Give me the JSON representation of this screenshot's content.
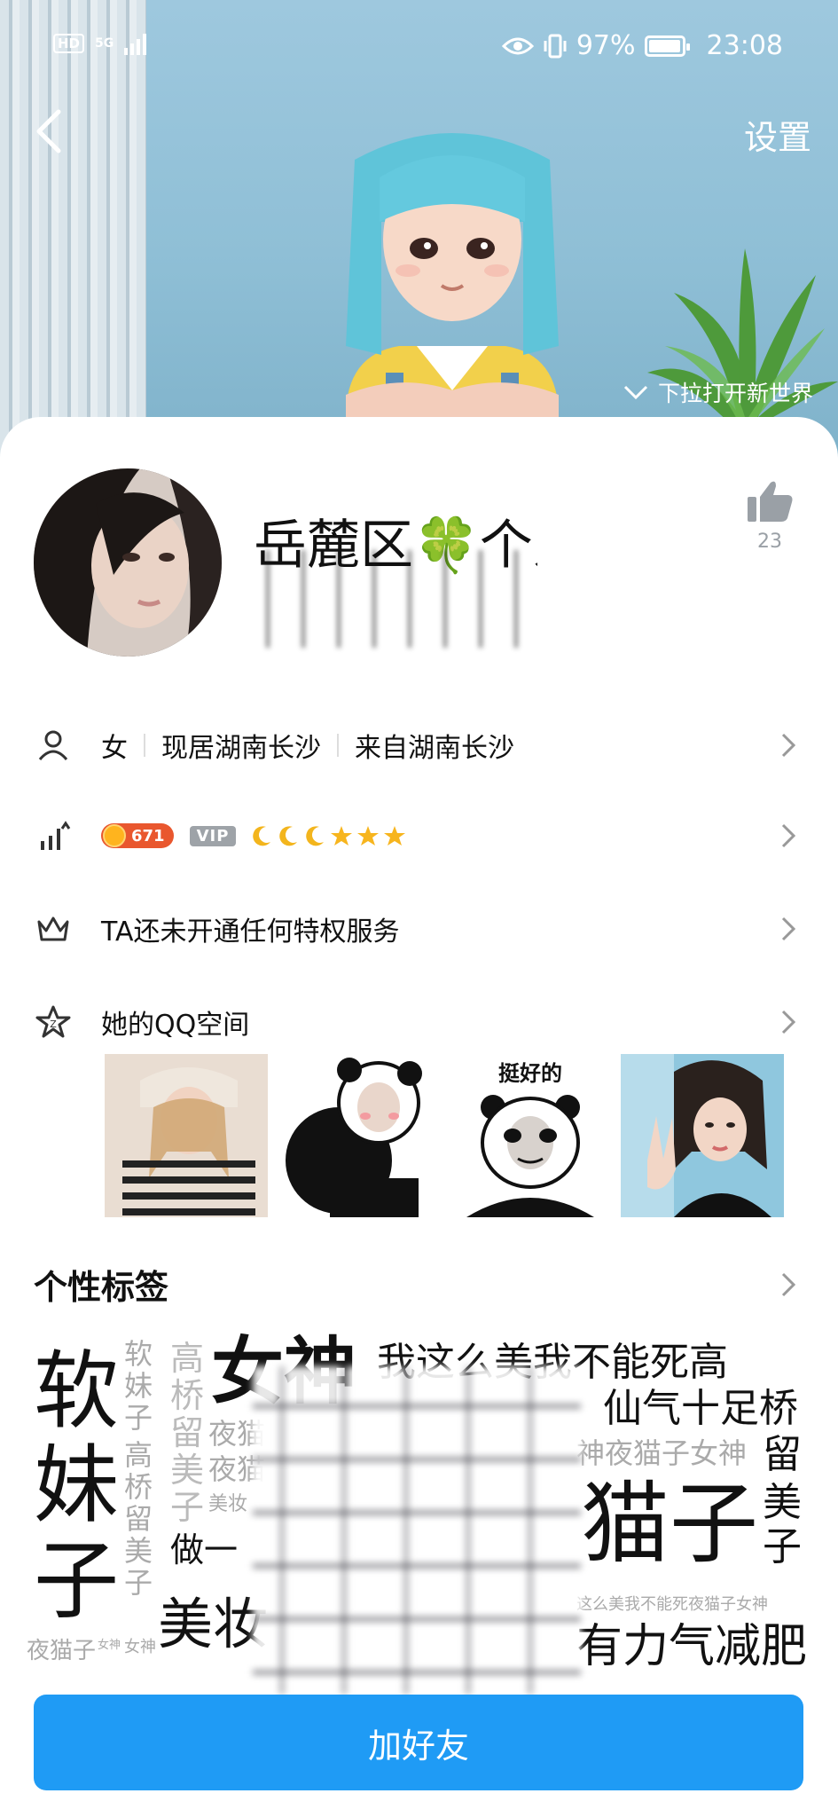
{
  "status_bar": {
    "hd": "HD",
    "network": "5G",
    "battery": "97%",
    "battery_level": 0.97,
    "time": "23:08"
  },
  "header": {
    "settings_label": "设置",
    "pull_hint": "下拉打开新世界"
  },
  "profile": {
    "nickname": "岳麓区🍀个人",
    "like_count": "23"
  },
  "info_rows": {
    "gender": "女",
    "location_current": "现居湖南长沙",
    "location_from": "来自湖南长沙",
    "level_value": "671",
    "vip_label": "VIP",
    "privilege_text": "TA还未开通任何特权服务",
    "qzone_text": "她的QQ空间"
  },
  "qzone_photos": [
    {
      "caption": ""
    },
    {
      "caption": ""
    },
    {
      "caption": "挺好的"
    },
    {
      "caption": ""
    }
  ],
  "tags_section": {
    "title": "个性标签",
    "tags": {
      "ruan": "软",
      "mei": "妹",
      "zi": "子",
      "nvshen": "女神",
      "wozhemeimei": "我这么美我不能死高",
      "xianqi": "仙气十足桥",
      "shenyemao": "神夜猫子女神",
      "liu": "留",
      "maozi": "猫子",
      "mei2": "美",
      "zi2": "子",
      "zuo": "做一",
      "meizhuang": "美妆",
      "youli": "有力气减肥",
      "smallline": "这么美我不能死夜猫子女神",
      "yemaozi": "夜猫子",
      "small_nvshen1": "女神",
      "small_nvshen2": "女神",
      "v_ruan": "软",
      "v_mei": "妹",
      "v_zi": "子",
      "v_gao": "高",
      "v_qiao": "桥",
      "v_liu": "留",
      "v_mei3": "美",
      "v_zi3": "子",
      "g_gao": "高",
      "g_qiao": "桥",
      "g_liu": "留",
      "g_mei": "美",
      "g_zi": "子",
      "g_ye": "夜猫",
      "g_ye2": "夜猫",
      "g_meizhuang": "美妆"
    }
  },
  "actions": {
    "add_friend": "加好友"
  },
  "colors": {
    "accent": "#1f9bf5",
    "level_badge": "#e9572e",
    "vip_badge": "#9ea3a8"
  }
}
